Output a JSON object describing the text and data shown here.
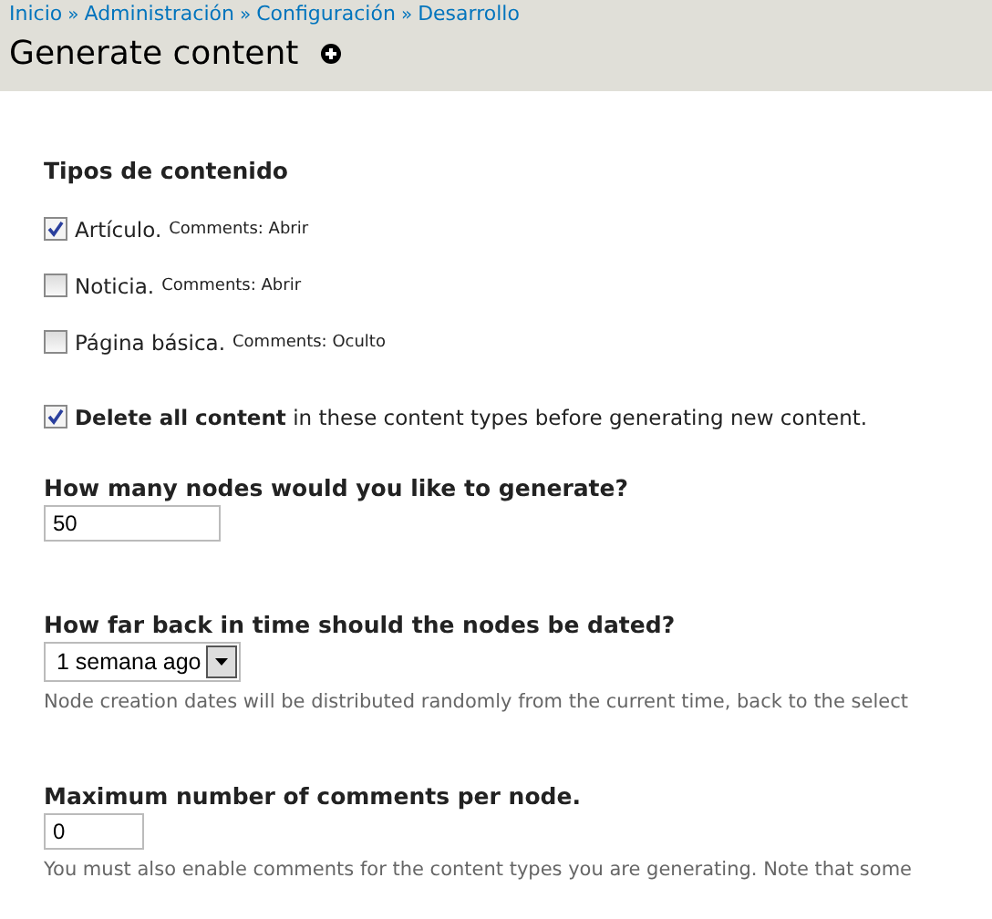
{
  "breadcrumb": [
    {
      "label": "Inicio"
    },
    {
      "label": "Administración"
    },
    {
      "label": "Configuración"
    },
    {
      "label": "Desarrollo"
    }
  ],
  "breadcrumb_separator": "»",
  "title": "Generate content",
  "content_types": {
    "label": "Tipos de contenido",
    "items": [
      {
        "name": "Artículo.",
        "comments": "Comments: Abrir",
        "checked": true
      },
      {
        "name": "Noticia.",
        "comments": "Comments: Abrir",
        "checked": false
      },
      {
        "name": "Página básica.",
        "comments": "Comments: Oculto",
        "checked": false
      }
    ]
  },
  "delete_all": {
    "label": "**Delete all content** in these content types before generating new content.",
    "checked": true
  },
  "fields": [
    {
      "kind": "text",
      "label": "How many nodes would you like to generate?",
      "value": "50"
    },
    {
      "kind": "select",
      "label": "How far back in time should the nodes be dated?",
      "value": "1 semana ago",
      "description": "Node creation dates will be distributed randomly from the current time, back to the select"
    },
    {
      "kind": "text",
      "label": "Maximum number of comments per node.",
      "value": "0",
      "description": "You must also enable comments for the content types you are generating. Note that some"
    }
  ]
}
